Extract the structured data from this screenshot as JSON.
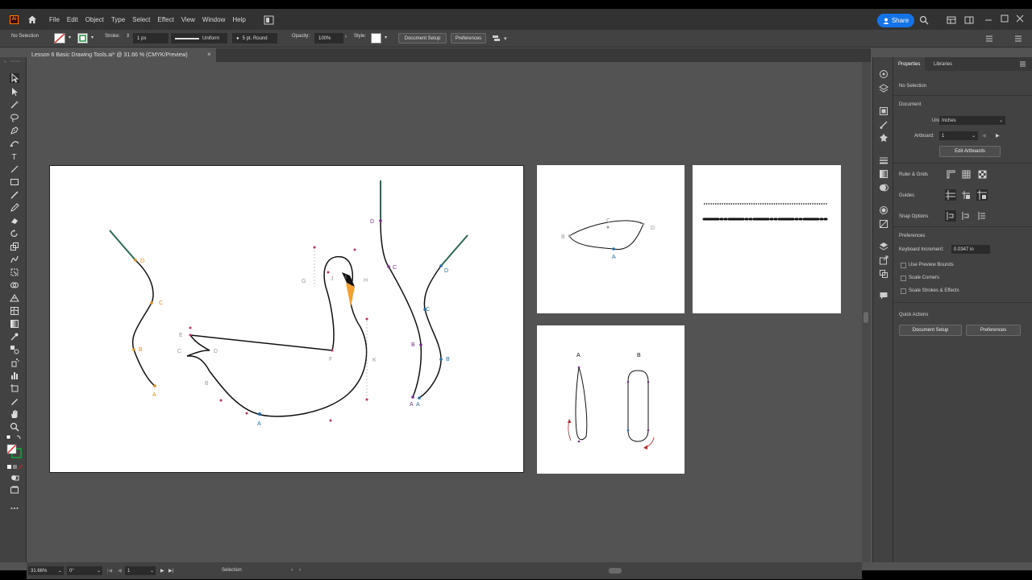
{
  "app": {
    "logo": "Ai",
    "menu": [
      "File",
      "Edit",
      "Object",
      "Type",
      "Select",
      "Effect",
      "View",
      "Window",
      "Help"
    ],
    "share_label": "Share"
  },
  "controlbar": {
    "selection": "No Selection",
    "stroke_label": "Stroke:",
    "stroke_value": "1 px",
    "profile": "Uniform",
    "brush": "5 pt. Round",
    "opacity_label": "Opacity:",
    "opacity_value": "100%",
    "style_label": "Style:",
    "doc_setup": "Document Setup",
    "preferences": "Preferences"
  },
  "document_tab": {
    "title": "Lesson 6 Basic Drawing Tools.ai* @ 31.66 % (CMYK/Preview)",
    "close": "×"
  },
  "properties": {
    "tabs": [
      "Properties",
      "Libraries"
    ],
    "selection": "No Selection",
    "document_heading": "Document",
    "units_label": "Units:",
    "units_value": "Inches",
    "artboard_label": "Artboard:",
    "artboard_value": "1",
    "edit_artboards": "Edit Artboards",
    "rulers_grids": "Ruler & Grids",
    "guides": "Guides",
    "snap_options": "Snap Options",
    "preferences_heading": "Preferences",
    "keyboard_increment_label": "Keyboard Increment:",
    "keyboard_increment_value": "0.0347 in",
    "checkboxes": [
      "Use Preview Bounds",
      "Scale Corners",
      "Scale Strokes & Effects"
    ],
    "quick_actions": "Quick Actions",
    "doc_setup": "Document Setup",
    "preferences": "Preferences"
  },
  "statusbar": {
    "zoom": "31.66%",
    "rotation": "0°",
    "artboard": "1",
    "tool": "Selection"
  },
  "artboard1": {
    "left_curve_labels": [
      "D",
      "C",
      "B",
      "A"
    ],
    "swan_labels": [
      "E",
      "C",
      "D",
      "B",
      "A",
      "F",
      "G",
      "J",
      "H",
      "I",
      "K"
    ],
    "right_curve1_labels": [
      "D",
      "C",
      "B",
      "A"
    ],
    "right_curve2_labels": [
      "D",
      "C",
      "B",
      "A"
    ]
  },
  "artboard2": {
    "labels": [
      "B",
      "C",
      "D",
      "A"
    ]
  },
  "artboard4": {
    "labels": [
      "A",
      "B"
    ]
  },
  "colors": {
    "orange_label": "#e08a1e",
    "purple_label": "#7a2c8c",
    "blue_label": "#1f6fa8",
    "accent": "#1473e6",
    "beak": "#f0a030"
  }
}
